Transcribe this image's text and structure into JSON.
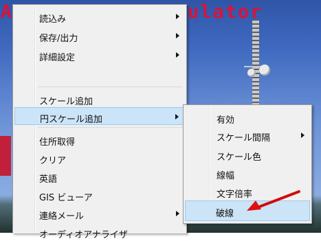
{
  "app": {
    "title_left": "A",
    "title_right": "ulator"
  },
  "main_menu": {
    "items": [
      {
        "label": "読込み",
        "has_submenu": true
      },
      {
        "label": "保存/出力",
        "has_submenu": true
      },
      {
        "label": "詳細設定",
        "has_submenu": true
      },
      {
        "label": "スケール追加",
        "has_submenu": false
      },
      {
        "label": "円スケール追加",
        "has_submenu": true,
        "highlighted": true
      },
      {
        "label": "住所取得",
        "has_submenu": false
      },
      {
        "label": "クリア",
        "has_submenu": false
      },
      {
        "label": "英語",
        "has_submenu": false
      },
      {
        "label": "GIS ビューア",
        "has_submenu": false
      },
      {
        "label": "連絡メール",
        "has_submenu": true
      },
      {
        "label": "オーディオアナライザ",
        "has_submenu": false
      }
    ]
  },
  "submenu_circle_scale": {
    "items": [
      {
        "label": "有効",
        "has_submenu": false
      },
      {
        "label": "スケール間隔",
        "has_submenu": true
      },
      {
        "label": "スケール色",
        "has_submenu": false
      },
      {
        "label": "線幅",
        "has_submenu": false
      },
      {
        "label": "文字倍率",
        "has_submenu": false
      },
      {
        "label": "破線",
        "has_submenu": false,
        "highlighted": true
      }
    ]
  },
  "colors": {
    "title_red": "#d8143a",
    "menu_bg": "#f0f0f0",
    "highlight_bg": "#cce4f7",
    "annotation_red": "#e01010"
  }
}
